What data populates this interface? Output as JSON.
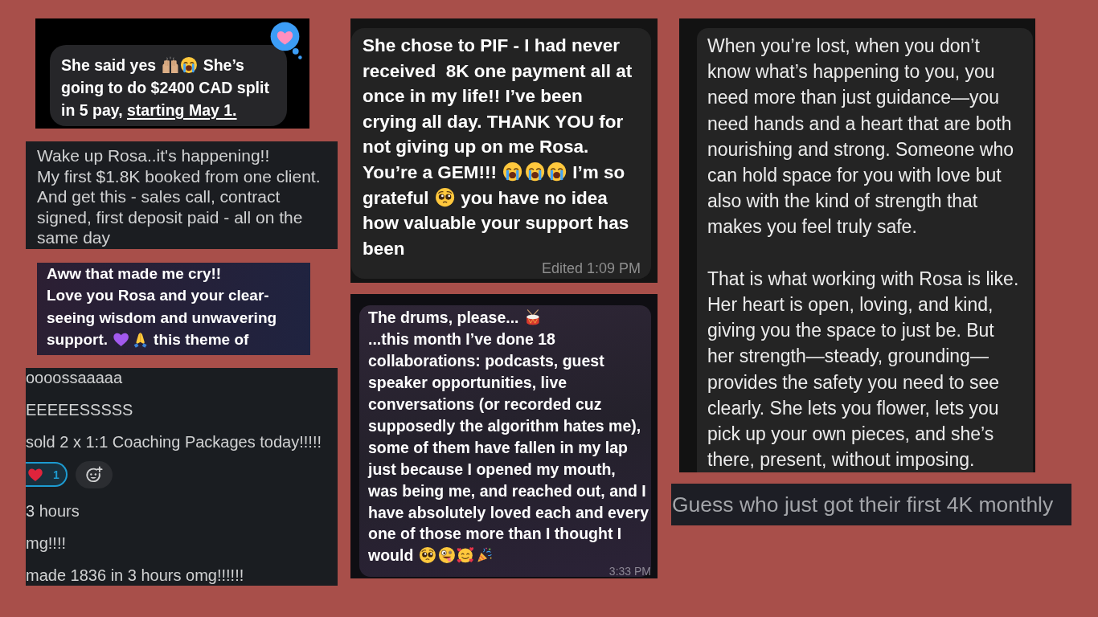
{
  "columns": [
    {
      "screenshots": [
        {
          "kind": "reply",
          "tapback": true,
          "paragraphs": [
            {
              "segments": [
                {
                  "kind": "text",
                  "text": "She said yes "
                },
                {
                  "kind": "hands"
                },
                {
                  "kind": "crying"
                },
                {
                  "kind": "text",
                  "text": " She’s going to do $2400 CAD split in 5 pay, "
                },
                {
                  "kind": "link",
                  "text": "starting May 1."
                }
              ]
            }
          ]
        },
        {
          "kind": "plain",
          "paragraphs": [
            {
              "text": "Wake up Rosa..it's happening!!"
            },
            {
              "text": "My first $1.8K booked from one client."
            },
            {
              "text": "And get this - sales call, contract signed, first deposit paid - all on the same day"
            }
          ]
        },
        {
          "kind": "dm",
          "paragraphs": [
            {
              "text": "Aww that made me cry!!"
            },
            {
              "segments": [
                {
                  "kind": "text",
                  "text": "Love you Rosa and your clear-seeing wisdom and unwavering support. "
                },
                {
                  "kind": "heart"
                },
                {
                  "kind": "pray"
                },
                {
                  "kind": "text",
                  "text": " this theme of"
                }
              ]
            }
          ]
        },
        {
          "kind": "thread",
          "rows": [
            {
              "kind": "text",
              "text": "oooossaaaaa"
            },
            {
              "kind": "text",
              "text": "EEEEESSSSS"
            },
            {
              "kind": "text",
              "text": "sold 2 x 1:1 Coaching Packages today!!!!!"
            },
            {
              "kind": "reactions",
              "count": "1",
              "selected": true
            },
            {
              "kind": "text",
              "text": "3 hours"
            },
            {
              "kind": "text",
              "text": "mg!!!!"
            },
            {
              "kind": "text",
              "text": "made 1836 in 3 hours omg!!!!!!"
            }
          ]
        }
      ]
    },
    {
      "screenshots": [
        {
          "kind": "bubble",
          "paragraphs": [
            {
              "segments": [
                {
                  "kind": "text",
                  "text": "She chose to PIF - I had never received  8K one payment all at once in my life!! I’ve been crying all day. THANK YOU for not giving up on me Rosa. You’re a GEM!!! "
                },
                {
                  "kind": "crying"
                },
                {
                  "kind": "crying"
                },
                {
                  "kind": "crying"
                },
                {
                  "kind": "text",
                  "text": " I’m so grateful "
                },
                {
                  "kind": "pleading"
                },
                {
                  "kind": "text",
                  "text": " you have no idea how valuable your support has been"
                }
              ]
            }
          ],
          "meta": "Edited 1:09 PM"
        },
        {
          "kind": "gradient",
          "paragraphs": [
            {
              "segments": [
                {
                  "kind": "text",
                  "text": "The drums, please... "
                },
                {
                  "kind": "drum"
                }
              ]
            },
            {
              "segments": [
                {
                  "kind": "text",
                  "text": "...this month I’ve done 18 collaborations: podcasts, guest speaker opportunities, live conversations (or recorded cuz supposedly the algorithm hates me), some of them have fallen in my lap just because I opened my mouth, was being me, and reached out, and I have absolutely loved each and every one of those more than I thought I would "
                },
                {
                  "kind": "pleading"
                },
                {
                  "kind": "zany"
                },
                {
                  "kind": "hearts"
                },
                {
                  "kind": "party"
                }
              ]
            }
          ],
          "meta": "3:33 PM"
        }
      ]
    },
    {
      "screenshots": [
        {
          "kind": "doodle",
          "paragraphs": [
            {
              "text": "When you’re lost, when you don’t know what’s happening to you, you need more than just guidance—you need hands and a heart that are both nourishing and strong. Someone who can hold space for you with love but also with the kind of strength that makes you feel truly safe."
            },
            {
              "text": "That is what working with Rosa is like. Her heart is open, loving, and kind, giving you the space to just be. But her strength—steady, grounding—provides the safety you need to see clearly. She lets you flower, lets you pick up your own pieces, and she’s there, present, without imposing."
            }
          ]
        },
        {
          "kind": "banner",
          "paragraphs": [
            {
              "text": "Guess who just got their first 4K monthly"
            }
          ]
        }
      ]
    }
  ]
}
